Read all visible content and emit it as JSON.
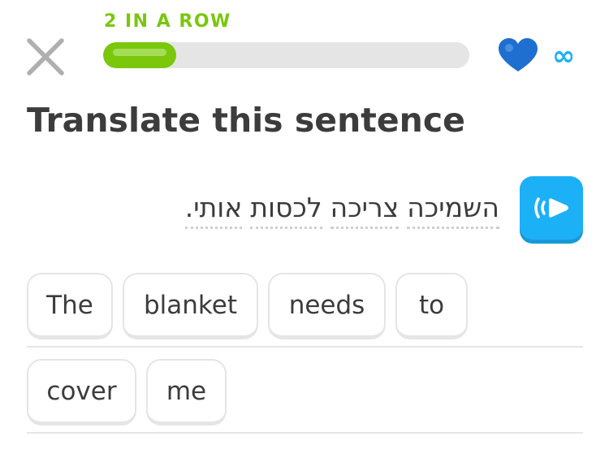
{
  "header": {
    "streak_label": "2 IN A ROW",
    "progress_fraction": 0.2,
    "lives": "∞",
    "colors": {
      "streak": "#7ac70c",
      "heart": "#1cb0f6"
    }
  },
  "challenge": {
    "title": "Translate this sentence",
    "prompt_words": [
      "השמיכה",
      "צריכה",
      "לכסות",
      "אותי."
    ],
    "audio_button_icon": "speaker-icon"
  },
  "answer": {
    "row1": [
      "The",
      "blanket",
      "needs",
      "to"
    ],
    "row2": [
      "cover",
      "me"
    ]
  }
}
